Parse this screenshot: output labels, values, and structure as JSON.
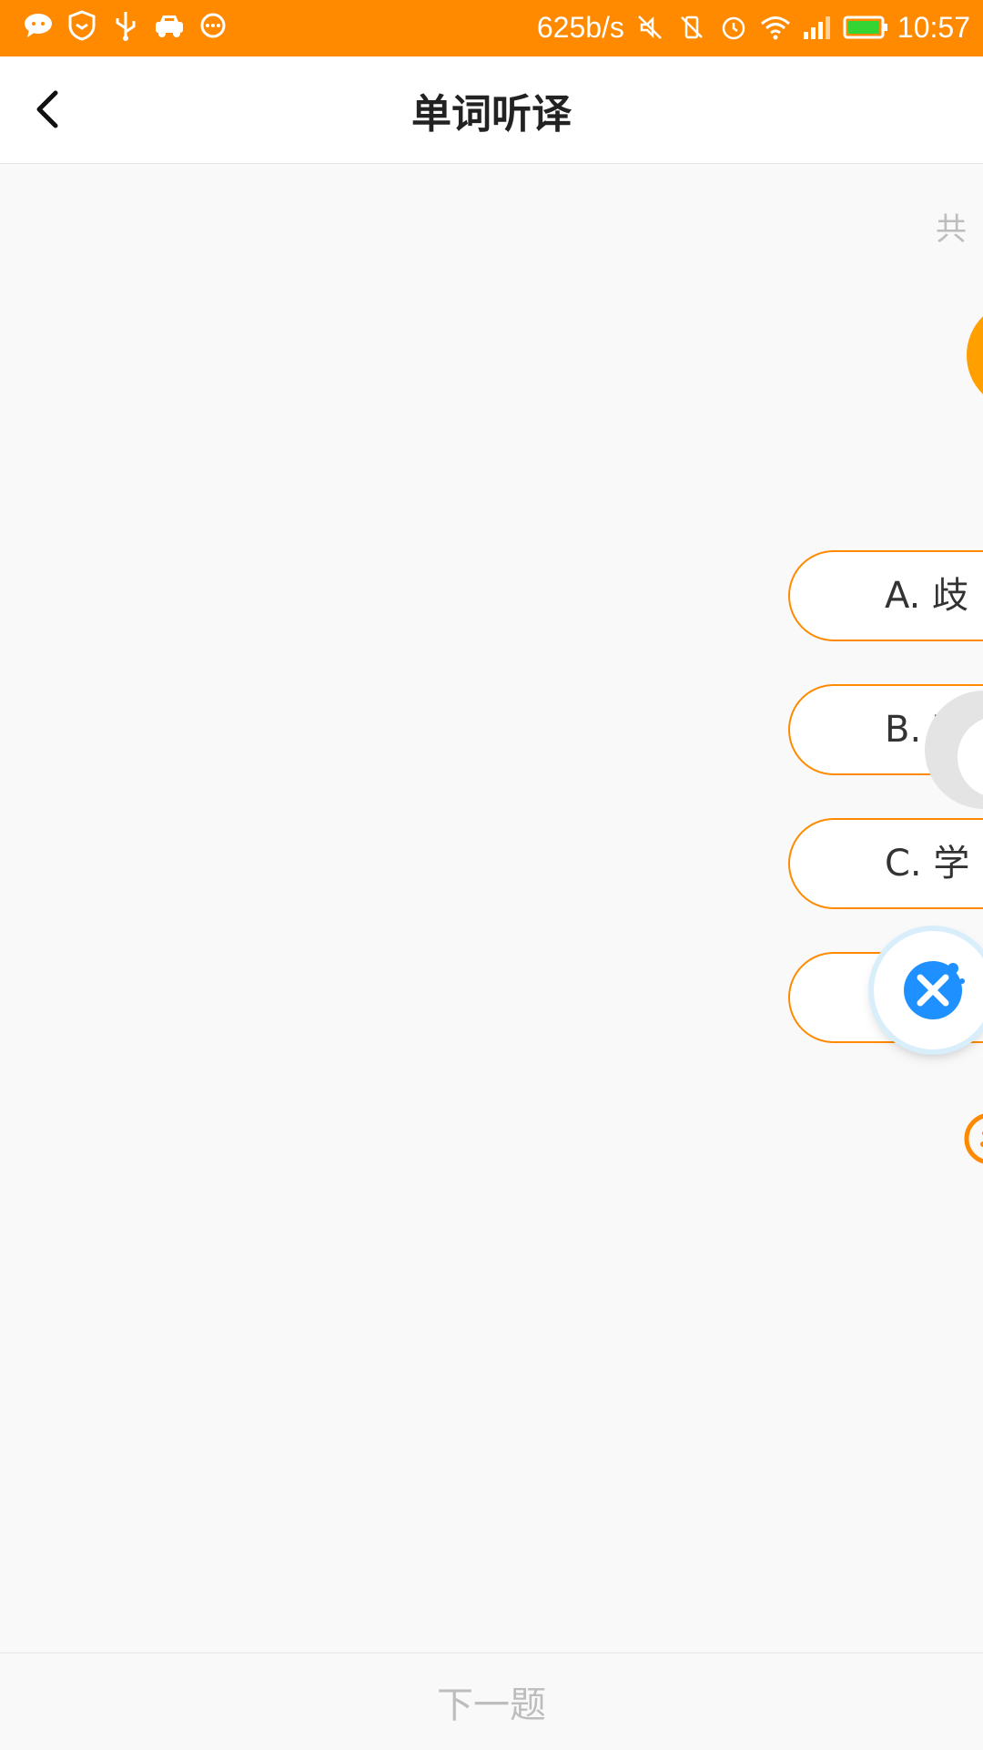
{
  "status_bar": {
    "network_speed": "625b/s",
    "time": "10:57",
    "left_icons": [
      "chat-bubble-icon",
      "shield-icon",
      "usb-icon",
      "car-icon",
      "more-dots-icon"
    ],
    "right_icons": [
      "mute-icon",
      "vibrate-off-icon",
      "alarm-icon",
      "wifi-icon",
      "signal-icon",
      "battery-icon"
    ],
    "background_color": "#ff8a00"
  },
  "header": {
    "title": "单词听译",
    "back_icon": "chevron-left-icon"
  },
  "main": {
    "count_text": "共",
    "options": [
      {
        "label": "A. 歧"
      },
      {
        "label": "B. 梦"
      },
      {
        "label": "C. 学"
      },
      {
        "label": ""
      }
    ],
    "accent_color": "#ff8a00"
  },
  "footer": {
    "next_label": "下一题"
  }
}
